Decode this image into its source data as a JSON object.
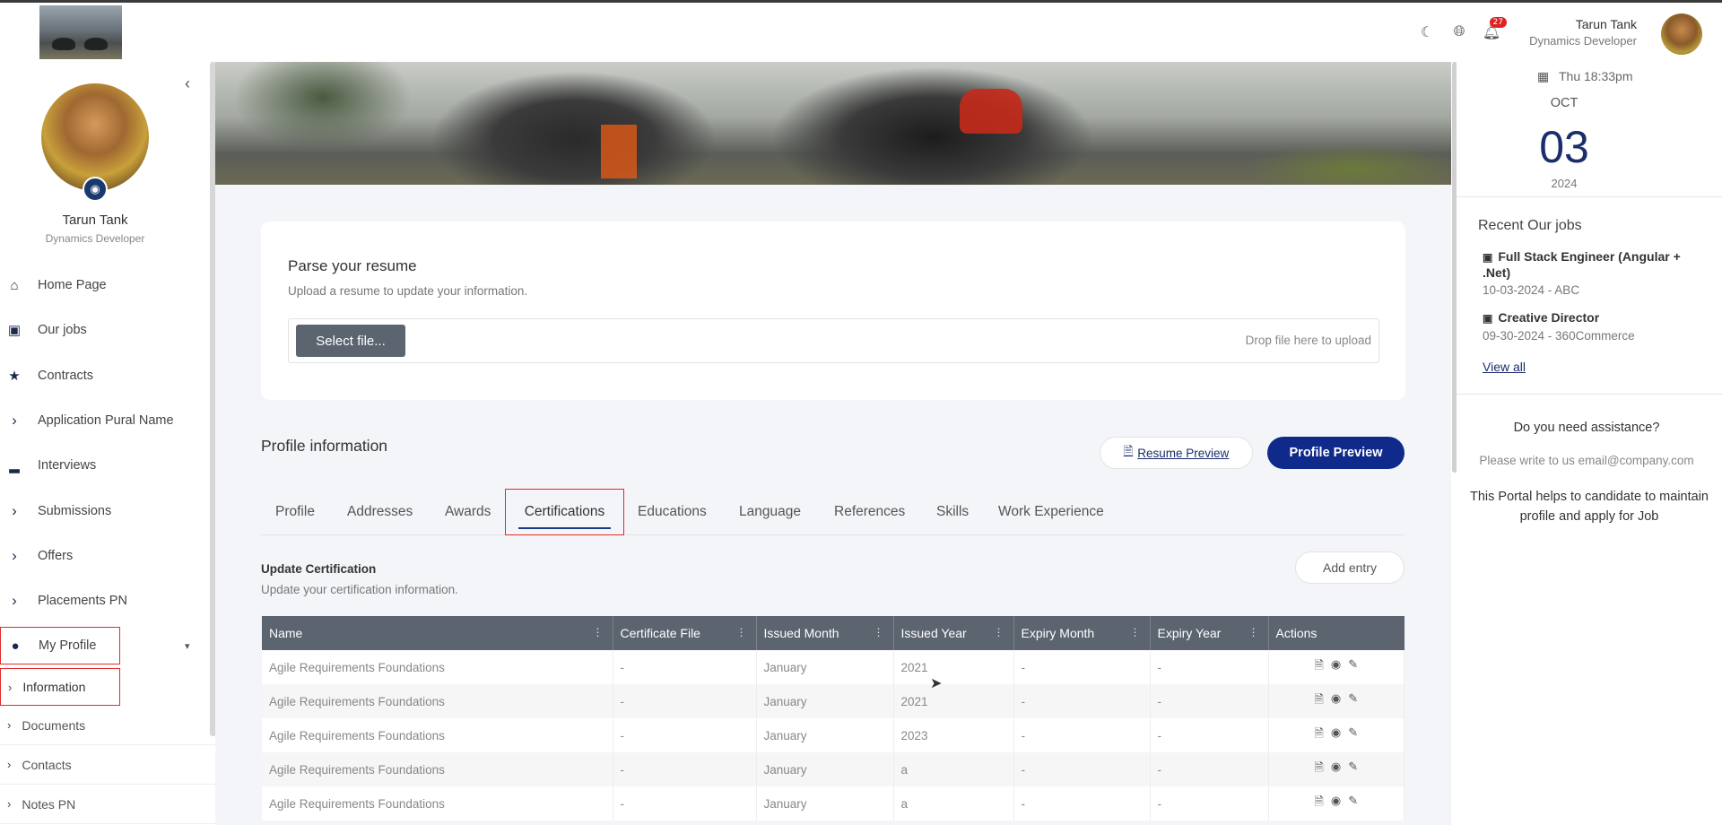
{
  "header": {
    "user_name": "Tarun Tank",
    "user_role": "Dynamics Developer",
    "notification_count": "27"
  },
  "sidebar": {
    "name": "Tarun Tank",
    "role": "Dynamics Developer",
    "items": [
      {
        "label": "Home Page",
        "icon": "home-icon"
      },
      {
        "label": "Our jobs",
        "icon": "briefcase-icon"
      },
      {
        "label": "Contracts",
        "icon": "star-icon"
      },
      {
        "label": "Application Pural Name",
        "icon": "chevron-right-icon"
      },
      {
        "label": "Interviews",
        "icon": "chart-icon"
      },
      {
        "label": "Submissions",
        "icon": "chevron-right-icon"
      },
      {
        "label": "Offers",
        "icon": "chevron-right-icon"
      },
      {
        "label": "Placements PN",
        "icon": "chevron-right-icon"
      },
      {
        "label": "My Profile",
        "icon": "user-icon"
      }
    ],
    "sub_items": [
      {
        "label": "Information"
      },
      {
        "label": "Documents"
      },
      {
        "label": "Contacts"
      },
      {
        "label": "Notes PN"
      }
    ]
  },
  "resume": {
    "title": "Parse your resume",
    "subtitle": "Upload a resume to update your information.",
    "select_button": "Select file...",
    "drop_text": "Drop file here to upload"
  },
  "profile": {
    "title": "Profile information",
    "resume_preview": "Resume Preview",
    "profile_preview": "Profile Preview",
    "tabs": [
      "Profile",
      "Addresses",
      "Awards",
      "Certifications",
      "Educations",
      "Language",
      "References",
      "Skills",
      "Work Experience"
    ],
    "active_tab": "Certifications"
  },
  "certification": {
    "title": "Update Certification",
    "subtitle": "Update your certification information.",
    "add_entry": "Add entry",
    "columns": [
      "Name",
      "Certificate File",
      "Issued Month",
      "Issued Year",
      "Expiry Month",
      "Expiry Year",
      "Actions"
    ],
    "rows": [
      [
        "Agile Requirements Foundations",
        "-",
        "January",
        "2021",
        "-",
        "-"
      ],
      [
        "Agile Requirements Foundations",
        "-",
        "January",
        "2021",
        "-",
        "-"
      ],
      [
        "Agile Requirements Foundations",
        "-",
        "January",
        "2023",
        "-",
        "-"
      ],
      [
        "Agile Requirements Foundations",
        "-",
        "January",
        "a",
        "-",
        "-"
      ],
      [
        "Agile Requirements Foundations",
        "-",
        "January",
        "a",
        "-",
        "-"
      ]
    ]
  },
  "right_panel": {
    "time": "Thu 18:33pm",
    "month": "OCT",
    "day": "03",
    "year": "2024",
    "jobs_title": "Recent Our jobs",
    "jobs": [
      {
        "title": "Full Stack Engineer (Angular + .Net)",
        "detail": "10-03-2024 - ABC"
      },
      {
        "title": "Creative Director",
        "detail": "09-30-2024 - 360Commerce"
      }
    ],
    "view_all": "View all",
    "assist_title": "Do you need assistance?",
    "assist_email": "Please write to us email@company.com",
    "assist_desc": "This Portal helps to candidate to maintain profile and apply for Job"
  },
  "colors": {
    "primary": "#0f2a8a",
    "table_header": "#5c6470",
    "highlight": "#e02b2b"
  }
}
